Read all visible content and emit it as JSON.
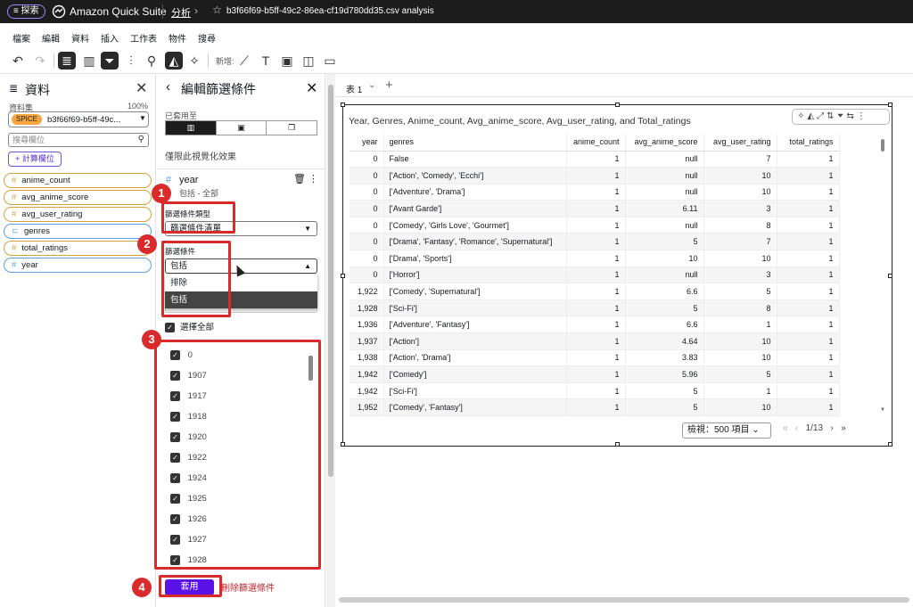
{
  "topbar": {
    "explore_label": "≡ 探索",
    "app_name": "Amazon Quick Suite",
    "crumb": "分析",
    "doc_name": "b3f66f69-b5ff-49c2-86ea-cf19d780dd35.csv analysis"
  },
  "menu": [
    "檔案",
    "編輯",
    "資料",
    "插入",
    "工作表",
    "物件",
    "搜尋"
  ],
  "toolbar": {
    "add_label": "新增:"
  },
  "data_panel": {
    "title": "資料",
    "dataset_label": "資料集",
    "dataset_pct": "100%",
    "spice": "SPICE",
    "dataset_name": "b3f66f69-b5ff-49c...",
    "search_placeholder": "搜尋欄位",
    "calc_field": "+ 計算欄位",
    "fields": [
      "anime_count",
      "avg_anime_score",
      "avg_user_rating",
      "genres",
      "total_ratings",
      "year"
    ]
  },
  "filter_panel": {
    "title": "編輯篩選條件",
    "applied_to": "已套用至",
    "only_this_visual": "僅限此視覺化效果",
    "field_name": "year",
    "field_sub": "包括 - 全部",
    "filter_type_label": "篩選條件類型",
    "filter_type_value": "篩選條件清單",
    "condition_label": "篩選條件",
    "condition_value": "包括",
    "dropdown_options": [
      "排除",
      "包括"
    ],
    "select_all": "選擇全部",
    "values": [
      "0",
      "1907",
      "1917",
      "1918",
      "1920",
      "1922",
      "1924",
      "1925",
      "1926",
      "1927",
      "1928"
    ],
    "apply": "套用",
    "remove": "刪除篩選條件"
  },
  "sheet": {
    "tab": "表 1"
  },
  "visual": {
    "title": "Year, Genres, Anime_count, Avg_anime_score, Avg_user_rating, and Total_ratings",
    "columns": [
      "year",
      "genres",
      "anime_count",
      "avg_anime_score",
      "avg_user_rating",
      "total_ratings"
    ],
    "rows": [
      [
        "0",
        "False",
        "1",
        "null",
        "7",
        "1"
      ],
      [
        "0",
        "['Action', 'Comedy', 'Ecchi']",
        "1",
        "null",
        "10",
        "1"
      ],
      [
        "0",
        "['Adventure', 'Drama']",
        "1",
        "null",
        "10",
        "1"
      ],
      [
        "0",
        "['Avant Garde']",
        "1",
        "6.11",
        "3",
        "1"
      ],
      [
        "0",
        "['Comedy', 'Girls Love', 'Gourmet']",
        "1",
        "null",
        "8",
        "1"
      ],
      [
        "0",
        "['Drama', 'Fantasy', 'Romance', 'Supernatural']",
        "1",
        "5",
        "7",
        "1"
      ],
      [
        "0",
        "['Drama', 'Sports']",
        "1",
        "10",
        "10",
        "1"
      ],
      [
        "0",
        "['Horror']",
        "1",
        "null",
        "3",
        "1"
      ],
      [
        "1,922",
        "['Comedy', 'Supernatural']",
        "1",
        "6.6",
        "5",
        "1"
      ],
      [
        "1,928",
        "['Sci-Fi']",
        "1",
        "5",
        "8",
        "1"
      ],
      [
        "1,936",
        "['Adventure', 'Fantasy']",
        "1",
        "6.6",
        "1",
        "1"
      ],
      [
        "1,937",
        "['Action']",
        "1",
        "4.64",
        "10",
        "1"
      ],
      [
        "1,938",
        "['Action', 'Drama']",
        "1",
        "3.83",
        "10",
        "1"
      ],
      [
        "1,942",
        "['Comedy']",
        "1",
        "5.96",
        "5",
        "1"
      ],
      [
        "1,942",
        "['Sci-Fi']",
        "1",
        "5",
        "1",
        "1"
      ],
      [
        "1,952",
        "['Comedy', 'Fantasy']",
        "1",
        "5",
        "10",
        "1"
      ]
    ],
    "view_label": "檢視：500 項目",
    "page": "1",
    "page_total": "/13"
  },
  "annotations": [
    "1",
    "2",
    "3",
    "4"
  ]
}
